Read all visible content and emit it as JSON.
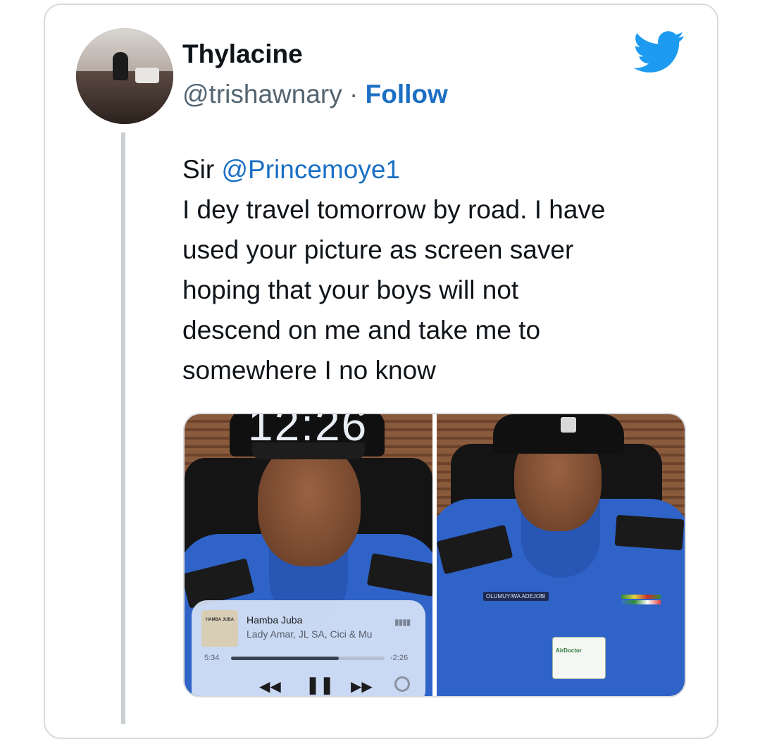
{
  "tweet": {
    "author_name": "Thylacine",
    "handle": "@trishawnary",
    "separator": "·",
    "follow_label": "Follow",
    "text_lines": [
      {
        "prefix": "Sir ",
        "mention": "@Princemoye1"
      },
      "I dey travel tomorrow by road. I have",
      "used your picture as screen saver",
      "hoping that your boys will not",
      "descend on me and take me to",
      "somewhere I no know"
    ]
  },
  "icons": {
    "brand": "twitter-bird-icon",
    "brand_color": "#1d9bf0",
    "link_color": "#1b6fc4"
  },
  "media": {
    "left_photo": {
      "lockscreen_time": "12:26",
      "player": {
        "album_art_text": "HAMBA JUBA",
        "song": "Hamba Juba",
        "artist": "Lady Amar, JL SA, Cici & Mu",
        "elapsed": "5:34",
        "remaining": "-2:26",
        "progress_fraction": 0.7
      }
    },
    "right_photo": {
      "name_tag": "OLUMUYIWA ADEJOBI",
      "id_card_text": "AirDoctor"
    }
  }
}
